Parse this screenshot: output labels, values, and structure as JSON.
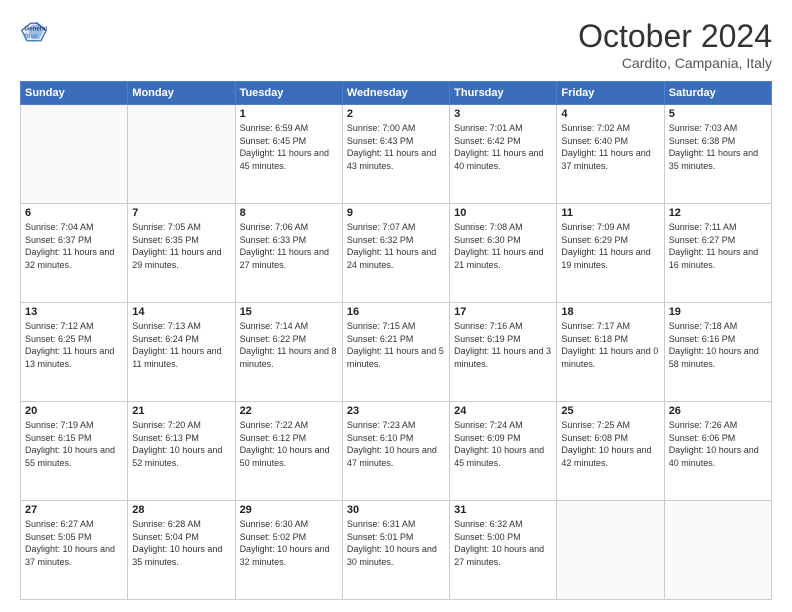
{
  "header": {
    "logo_line1": "General",
    "logo_line2": "Blue",
    "month": "October 2024",
    "location": "Cardito, Campania, Italy"
  },
  "weekdays": [
    "Sunday",
    "Monday",
    "Tuesday",
    "Wednesday",
    "Thursday",
    "Friday",
    "Saturday"
  ],
  "weeks": [
    [
      {
        "day": "",
        "info": ""
      },
      {
        "day": "",
        "info": ""
      },
      {
        "day": "1",
        "info": "Sunrise: 6:59 AM\nSunset: 6:45 PM\nDaylight: 11 hours and 45 minutes."
      },
      {
        "day": "2",
        "info": "Sunrise: 7:00 AM\nSunset: 6:43 PM\nDaylight: 11 hours and 43 minutes."
      },
      {
        "day": "3",
        "info": "Sunrise: 7:01 AM\nSunset: 6:42 PM\nDaylight: 11 hours and 40 minutes."
      },
      {
        "day": "4",
        "info": "Sunrise: 7:02 AM\nSunset: 6:40 PM\nDaylight: 11 hours and 37 minutes."
      },
      {
        "day": "5",
        "info": "Sunrise: 7:03 AM\nSunset: 6:38 PM\nDaylight: 11 hours and 35 minutes."
      }
    ],
    [
      {
        "day": "6",
        "info": "Sunrise: 7:04 AM\nSunset: 6:37 PM\nDaylight: 11 hours and 32 minutes."
      },
      {
        "day": "7",
        "info": "Sunrise: 7:05 AM\nSunset: 6:35 PM\nDaylight: 11 hours and 29 minutes."
      },
      {
        "day": "8",
        "info": "Sunrise: 7:06 AM\nSunset: 6:33 PM\nDaylight: 11 hours and 27 minutes."
      },
      {
        "day": "9",
        "info": "Sunrise: 7:07 AM\nSunset: 6:32 PM\nDaylight: 11 hours and 24 minutes."
      },
      {
        "day": "10",
        "info": "Sunrise: 7:08 AM\nSunset: 6:30 PM\nDaylight: 11 hours and 21 minutes."
      },
      {
        "day": "11",
        "info": "Sunrise: 7:09 AM\nSunset: 6:29 PM\nDaylight: 11 hours and 19 minutes."
      },
      {
        "day": "12",
        "info": "Sunrise: 7:11 AM\nSunset: 6:27 PM\nDaylight: 11 hours and 16 minutes."
      }
    ],
    [
      {
        "day": "13",
        "info": "Sunrise: 7:12 AM\nSunset: 6:25 PM\nDaylight: 11 hours and 13 minutes."
      },
      {
        "day": "14",
        "info": "Sunrise: 7:13 AM\nSunset: 6:24 PM\nDaylight: 11 hours and 11 minutes."
      },
      {
        "day": "15",
        "info": "Sunrise: 7:14 AM\nSunset: 6:22 PM\nDaylight: 11 hours and 8 minutes."
      },
      {
        "day": "16",
        "info": "Sunrise: 7:15 AM\nSunset: 6:21 PM\nDaylight: 11 hours and 5 minutes."
      },
      {
        "day": "17",
        "info": "Sunrise: 7:16 AM\nSunset: 6:19 PM\nDaylight: 11 hours and 3 minutes."
      },
      {
        "day": "18",
        "info": "Sunrise: 7:17 AM\nSunset: 6:18 PM\nDaylight: 11 hours and 0 minutes."
      },
      {
        "day": "19",
        "info": "Sunrise: 7:18 AM\nSunset: 6:16 PM\nDaylight: 10 hours and 58 minutes."
      }
    ],
    [
      {
        "day": "20",
        "info": "Sunrise: 7:19 AM\nSunset: 6:15 PM\nDaylight: 10 hours and 55 minutes."
      },
      {
        "day": "21",
        "info": "Sunrise: 7:20 AM\nSunset: 6:13 PM\nDaylight: 10 hours and 52 minutes."
      },
      {
        "day": "22",
        "info": "Sunrise: 7:22 AM\nSunset: 6:12 PM\nDaylight: 10 hours and 50 minutes."
      },
      {
        "day": "23",
        "info": "Sunrise: 7:23 AM\nSunset: 6:10 PM\nDaylight: 10 hours and 47 minutes."
      },
      {
        "day": "24",
        "info": "Sunrise: 7:24 AM\nSunset: 6:09 PM\nDaylight: 10 hours and 45 minutes."
      },
      {
        "day": "25",
        "info": "Sunrise: 7:25 AM\nSunset: 6:08 PM\nDaylight: 10 hours and 42 minutes."
      },
      {
        "day": "26",
        "info": "Sunrise: 7:26 AM\nSunset: 6:06 PM\nDaylight: 10 hours and 40 minutes."
      }
    ],
    [
      {
        "day": "27",
        "info": "Sunrise: 6:27 AM\nSunset: 5:05 PM\nDaylight: 10 hours and 37 minutes."
      },
      {
        "day": "28",
        "info": "Sunrise: 6:28 AM\nSunset: 5:04 PM\nDaylight: 10 hours and 35 minutes."
      },
      {
        "day": "29",
        "info": "Sunrise: 6:30 AM\nSunset: 5:02 PM\nDaylight: 10 hours and 32 minutes."
      },
      {
        "day": "30",
        "info": "Sunrise: 6:31 AM\nSunset: 5:01 PM\nDaylight: 10 hours and 30 minutes."
      },
      {
        "day": "31",
        "info": "Sunrise: 6:32 AM\nSunset: 5:00 PM\nDaylight: 10 hours and 27 minutes."
      },
      {
        "day": "",
        "info": ""
      },
      {
        "day": "",
        "info": ""
      }
    ]
  ]
}
